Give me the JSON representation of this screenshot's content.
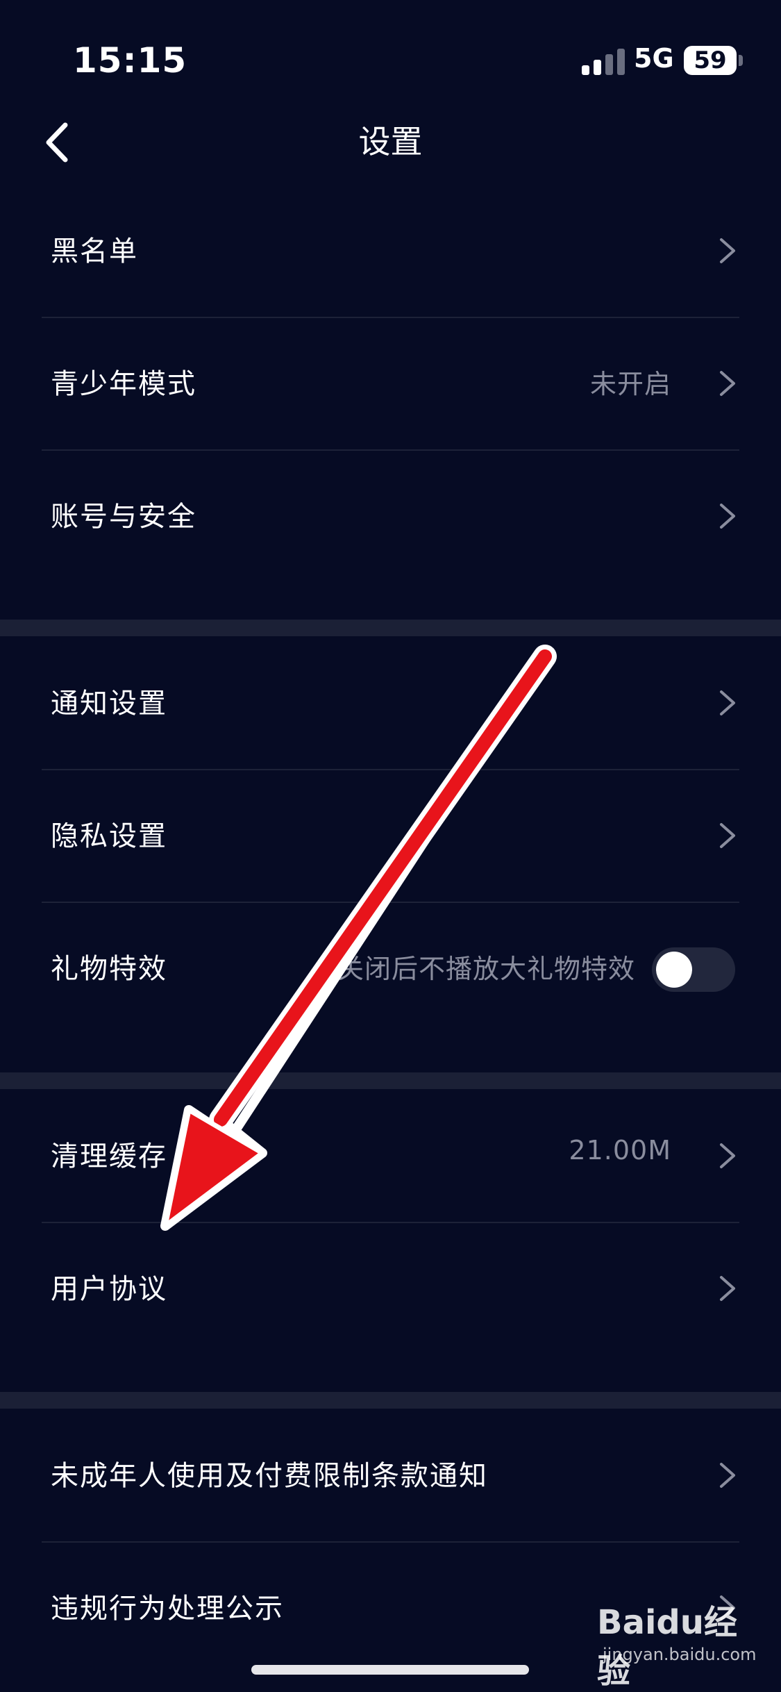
{
  "status_bar": {
    "time": "15:15",
    "network": "5G",
    "battery": "59"
  },
  "header": {
    "title": "设置"
  },
  "groups": [
    {
      "items": [
        {
          "label": "黑名单",
          "value": ""
        },
        {
          "label": "青少年模式",
          "value": "未开启"
        },
        {
          "label": "账号与安全",
          "value": ""
        }
      ]
    },
    {
      "items": [
        {
          "label": "通知设置",
          "value": ""
        },
        {
          "label": "隐私设置",
          "value": ""
        },
        {
          "label": "礼物特效",
          "value": "关闭后不播放大礼物特效",
          "toggle_on": false
        }
      ]
    },
    {
      "items": [
        {
          "label": "清理缓存",
          "value": "21.00M"
        },
        {
          "label": "用户协议",
          "value": ""
        }
      ]
    },
    {
      "items": [
        {
          "label": "未成年人使用及付费限制条款通知",
          "value": ""
        },
        {
          "label": "违规行为处理公示",
          "value": ""
        }
      ]
    }
  ],
  "watermark": {
    "brand": "Baidu经验",
    "url": "jingyan.baidu.com"
  },
  "colors": {
    "background": "#060b24",
    "separator": "#1b2036",
    "secondary_text": "#8a8d9e",
    "annotation_arrow": "#e8141b"
  },
  "icons": {
    "back": "chevron-left-icon",
    "row_arrow": "chevron-right-icon"
  }
}
